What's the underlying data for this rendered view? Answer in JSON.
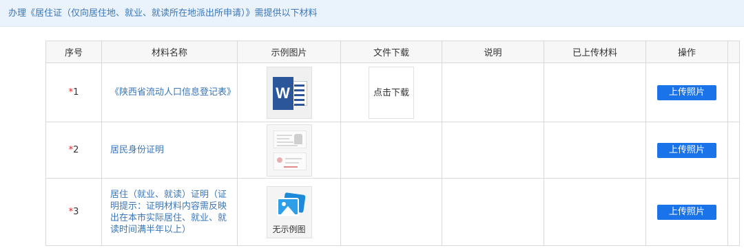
{
  "header": {
    "title": "办理《居住证（仅向居住地、就业、就读所在地派出所申请）》需提供以下材料"
  },
  "table": {
    "columns": [
      "序号",
      "材料名称",
      "示例图片",
      "文件下载",
      "说明",
      "已上传材料",
      "操作",
      ""
    ],
    "rows": [
      {
        "required_mark": "*",
        "index": "1",
        "name": "《陕西省流动人口信息登记表》",
        "example_icon": "word-document-icon",
        "download_label": "点击下载",
        "note": "",
        "uploaded": "",
        "action_label": "上传照片"
      },
      {
        "required_mark": "*",
        "index": "2",
        "name": "居民身份证明",
        "example_icon": "id-card-thumbnail",
        "download_label": "",
        "note": "",
        "uploaded": "",
        "action_label": "上传照片"
      },
      {
        "required_mark": "*",
        "index": "3",
        "name": "居住（就业、就读）证明（证明提示：证明材料内容需反映出在本市实际居住、就业、就读时间满半年以上）",
        "example_icon": "no-image-icon",
        "example_caption": "无示例图",
        "download_label": "",
        "note": "",
        "uploaded": "",
        "action_label": "上传照片"
      }
    ]
  },
  "colors": {
    "header_bg": "#eaf3fb",
    "link_text": "#3a76b8",
    "required_star": "#e02020",
    "button_bg": "#1a73e8"
  }
}
